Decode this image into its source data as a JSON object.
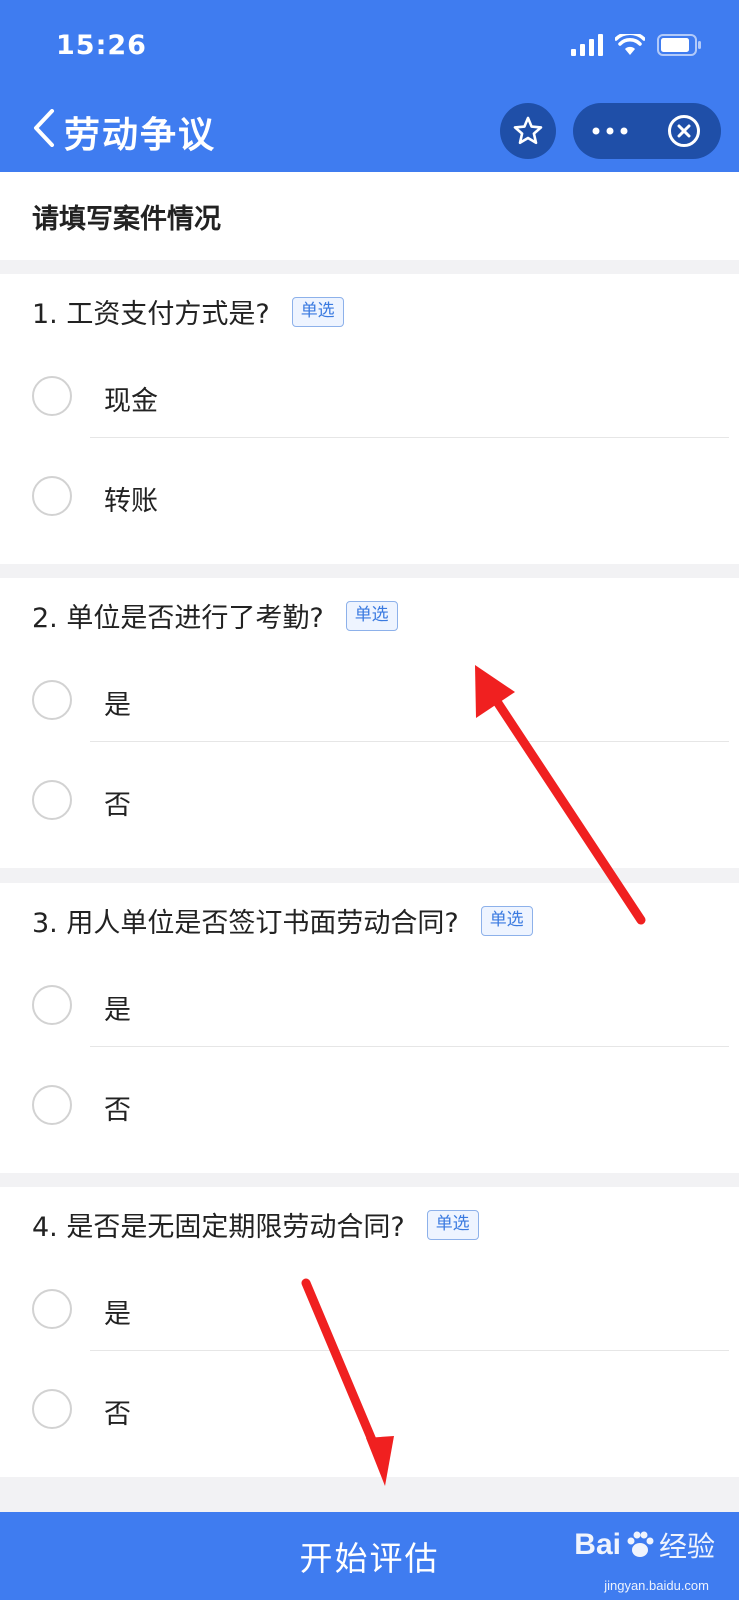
{
  "status_bar": {
    "time": "15:26"
  },
  "nav": {
    "title": "劳动争议"
  },
  "section": {
    "title": "请填写案件情况"
  },
  "questions": [
    {
      "title": "1. 工资支付方式是?",
      "tag": "单选",
      "options": [
        "现金",
        "转账"
      ]
    },
    {
      "title": "2. 单位是否进行了考勤?",
      "tag": "单选",
      "options": [
        "是",
        "否"
      ]
    },
    {
      "title": "3. 用人单位是否签订书面劳动合同?",
      "tag": "单选",
      "options": [
        "是",
        "否"
      ]
    },
    {
      "title": "4. 是否是无固定期限劳动合同?",
      "tag": "单选",
      "options": [
        "是",
        "否"
      ]
    }
  ],
  "footer": {
    "start_label": "开始评估"
  },
  "watermark": {
    "logo": "Bai",
    "text": "经验",
    "url": "jingyan.baidu.com"
  },
  "colors": {
    "primary": "#3f7cf0",
    "capsule": "#1f4fa8",
    "annotation": "#f02020"
  },
  "icons": [
    "back-icon",
    "star-icon",
    "more-icon",
    "close-icon",
    "signal-icon",
    "wifi-icon",
    "battery-icon"
  ]
}
